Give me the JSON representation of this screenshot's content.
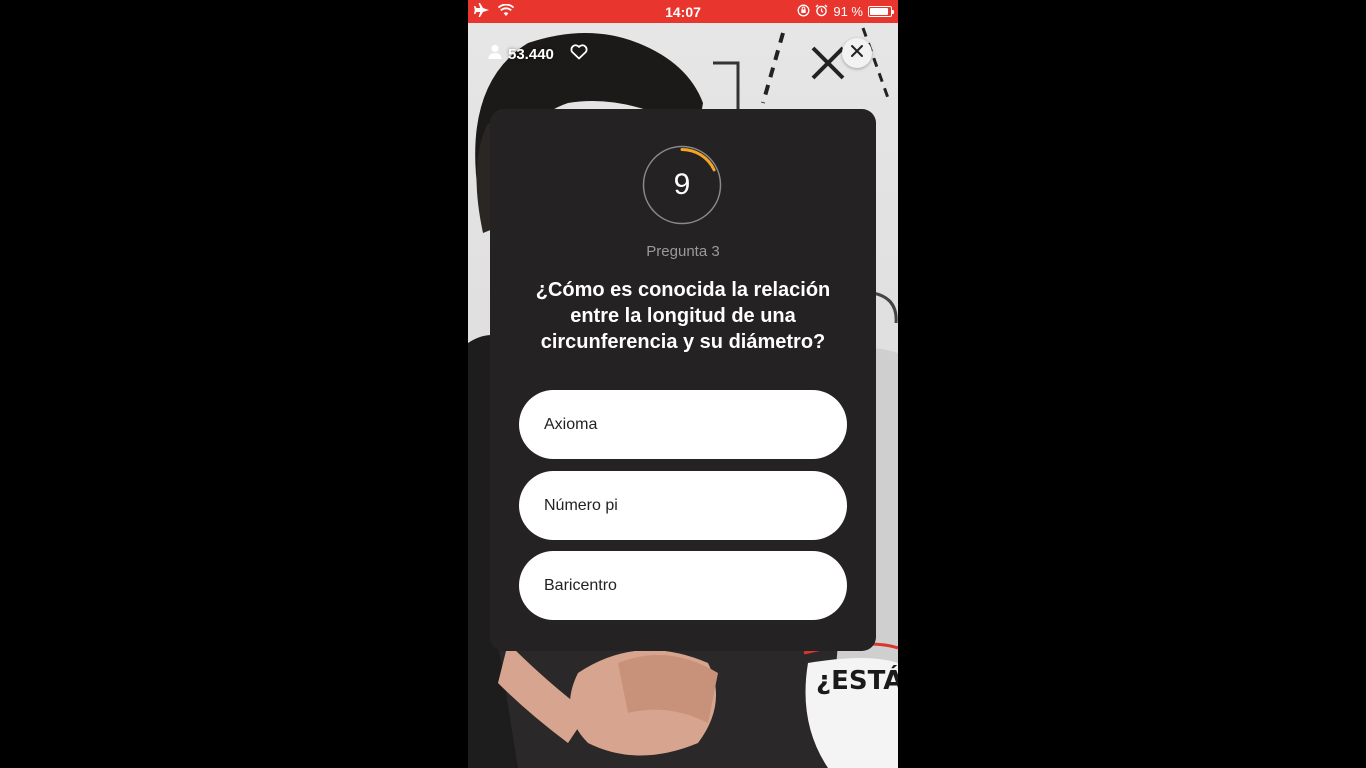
{
  "status_bar": {
    "time": "14:07",
    "battery_text": "91 %",
    "battery_level": 0.91,
    "icons": [
      "airplane-icon",
      "wifi-icon",
      "orientation-lock-icon",
      "alarm-icon",
      "battery-icon"
    ],
    "color": "#e8362f"
  },
  "overlay": {
    "viewer_count": "53.440",
    "icons": [
      "user-icon",
      "heart-icon",
      "close-icon"
    ]
  },
  "background": {
    "whiteboard_text": "¿ESTÁS"
  },
  "quiz": {
    "timer_value": "9",
    "timer_progress": 0.18,
    "timer_color": "#f5a623",
    "question_label": "Pregunta 3",
    "question_text": "¿Cómo es conocida la relación entre la longitud de una circunferencia y su diámetro?",
    "answers": [
      {
        "label": "Axioma"
      },
      {
        "label": "Número pi"
      },
      {
        "label": "Baricentro"
      }
    ]
  }
}
